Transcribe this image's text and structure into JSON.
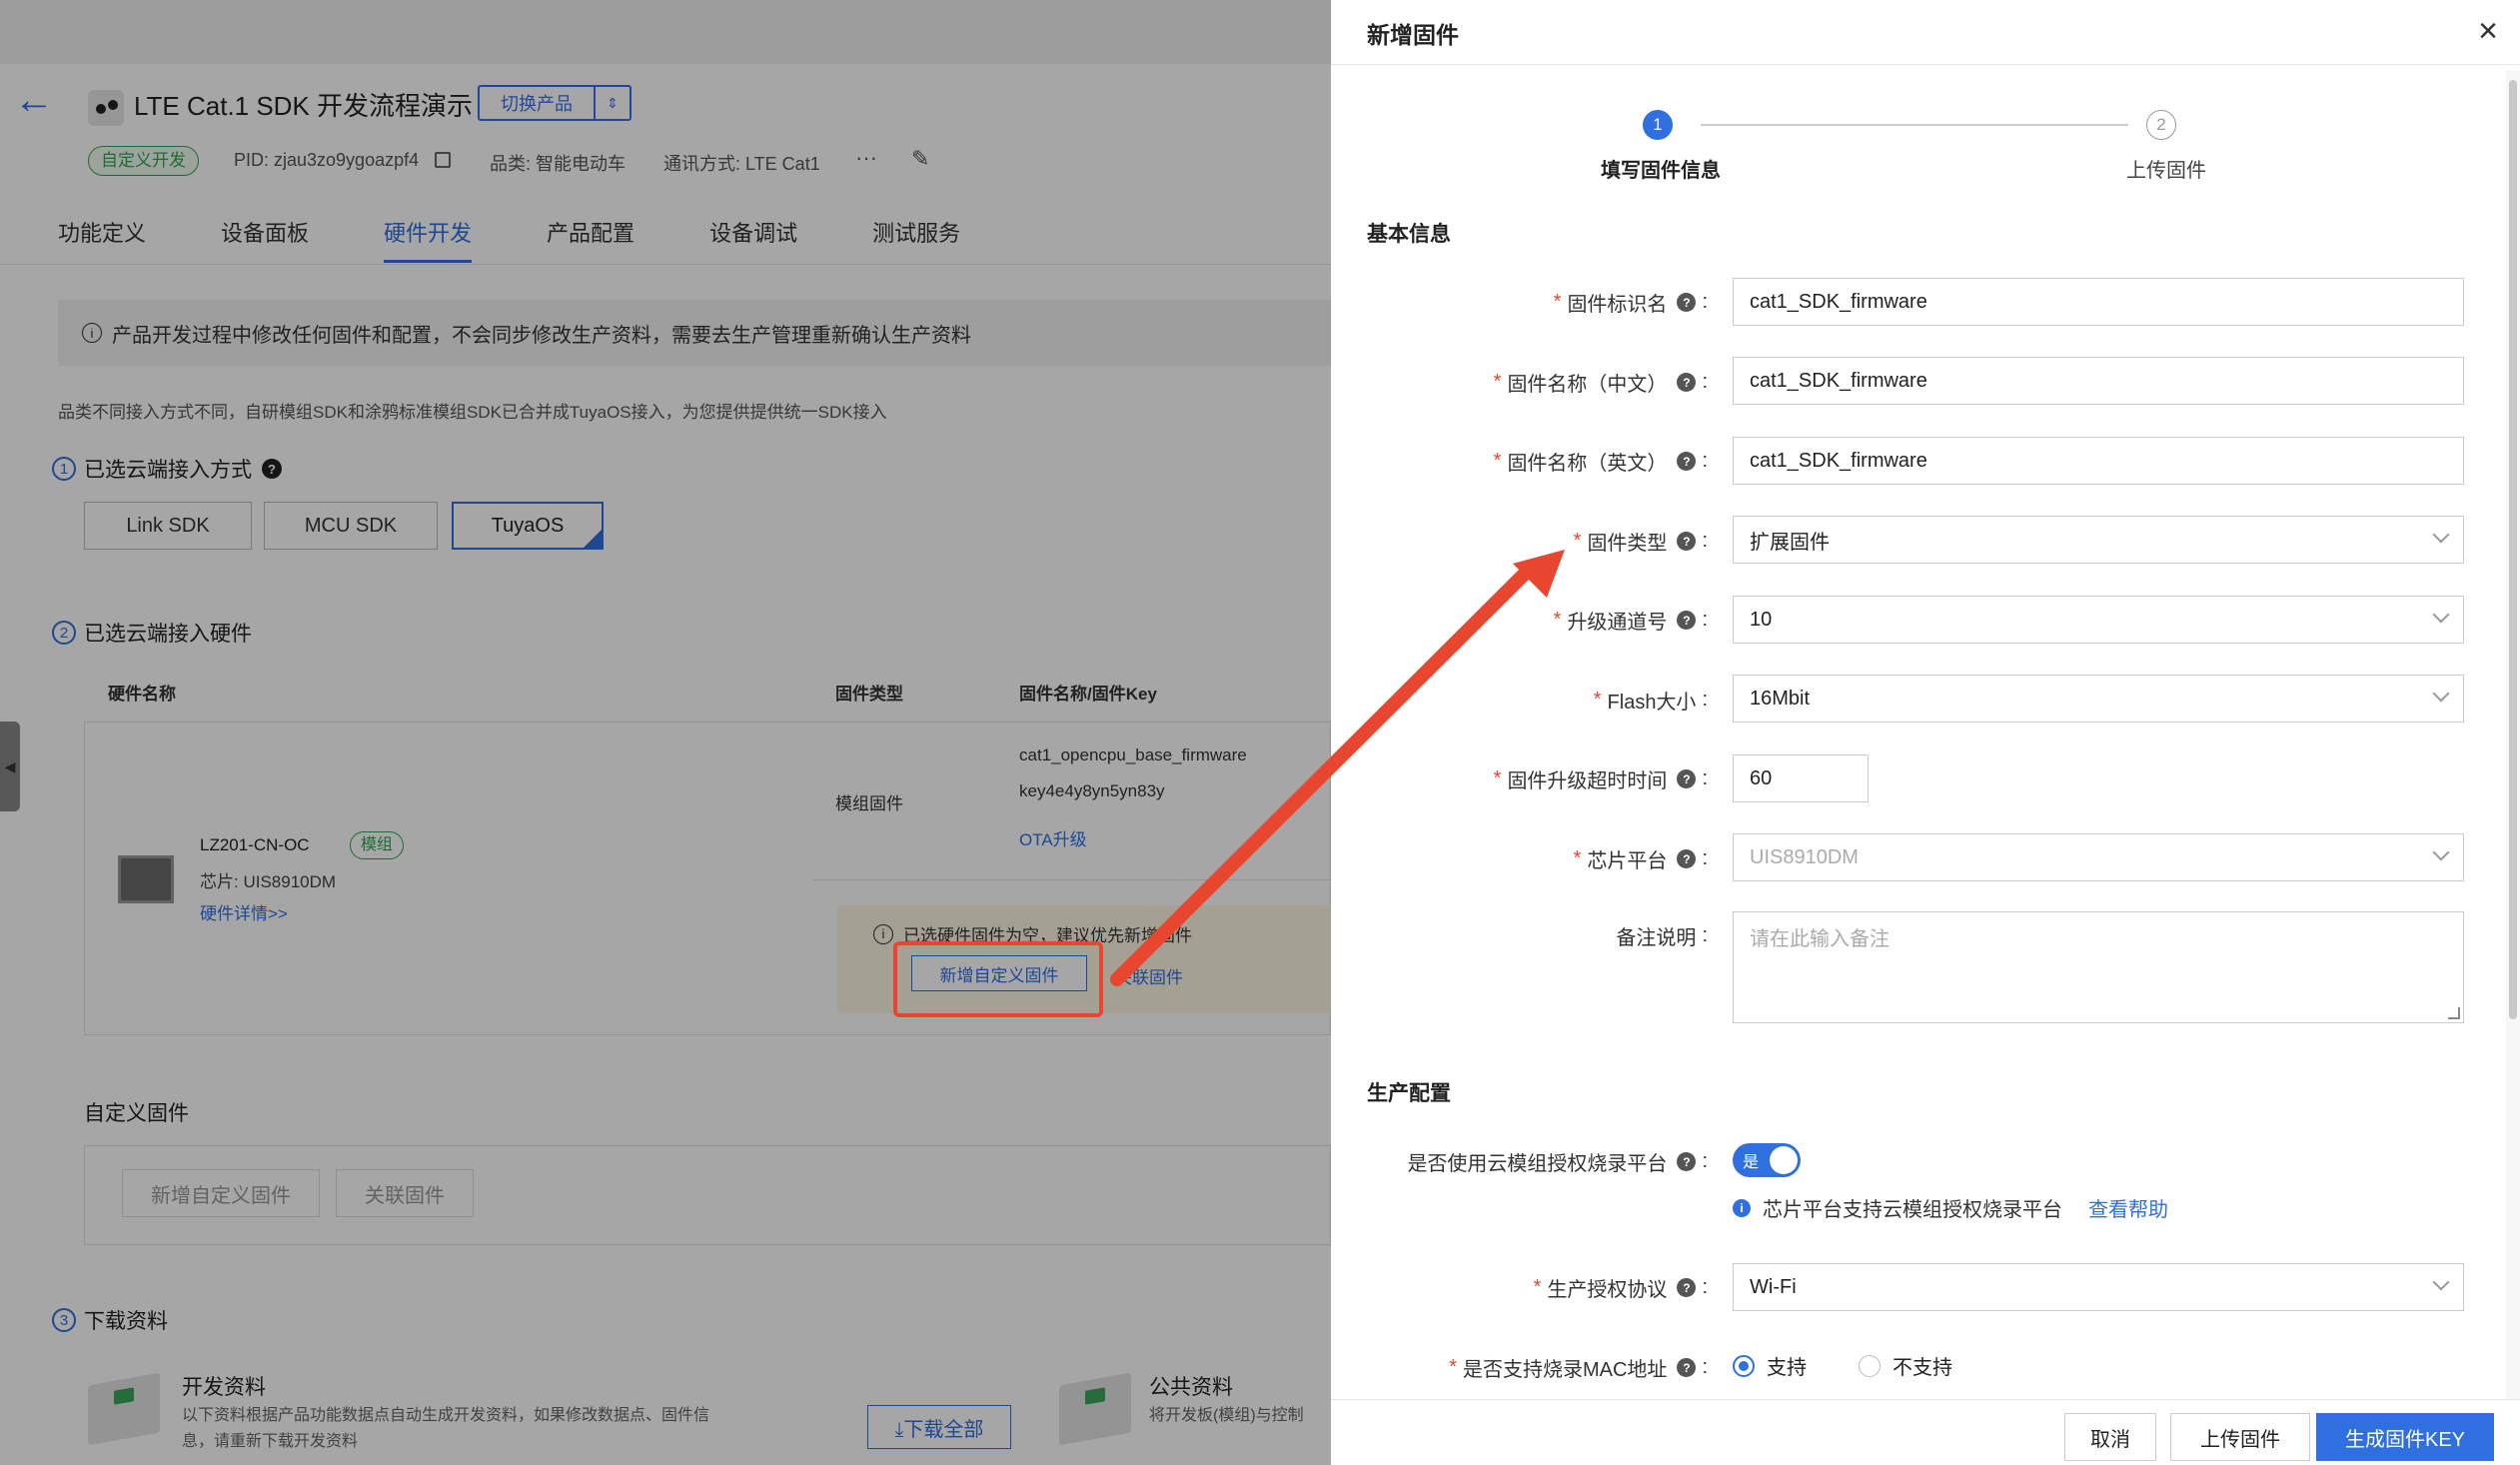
{
  "page": {
    "product_title": "LTE Cat.1 SDK 开发流程演示",
    "switch_product": "切换产品",
    "custom_dev_tag": "自定义开发",
    "pid": "PID: zjau3zo9ygoazpf4",
    "category": "品类: 智能电动车",
    "comm": "通讯方式: LTE Cat1",
    "more": "···",
    "tabs": [
      "功能定义",
      "设备面板",
      "硬件开发",
      "产品配置",
      "设备调试",
      "测试服务"
    ],
    "notice": "产品开发过程中修改任何固件和配置，不会同步修改生产资料，需要去生产管理重新确认生产资料",
    "desc": "品类不同接入方式不同，自研模组SDK和涂鸦标准模组SDK已合并成TuyaOS接入，为您提供提供统一SDK接入",
    "section1": {
      "num": "1",
      "title": "已选云端接入方式"
    },
    "sdk_options": [
      "Link SDK",
      "MCU SDK",
      "TuyaOS"
    ],
    "section2": {
      "num": "2",
      "title": "已选云端接入硬件"
    },
    "table_headers": [
      "硬件名称",
      "固件类型",
      "固件名称/固件Key"
    ],
    "hardware": {
      "name": "LZ201-CN-OC",
      "tag": "模组",
      "chip": "芯片: UIS8910DM",
      "link": "硬件详情>>",
      "fw_type": "模组固件",
      "fw_name": "cat1_opencpu_base_firmware",
      "fw_key": "key4e4y8yn5yn83y",
      "ota": "OTA升级"
    },
    "warning": "已选硬件固件为空，建议优先新增固件",
    "add_custom_fw": "新增自定义固件",
    "link_fw": "关联固件",
    "custom_fw_title": "自定义固件",
    "ghost_add": "新增自定义固件",
    "ghost_link": "关联固件",
    "section3": {
      "num": "3",
      "title": "下载资料"
    },
    "dev_doc_title": "开发资料",
    "dev_doc_desc1": "以下资料根据产品功能数据点自动生成开发资料，如果修改数据点、固件信",
    "dev_doc_desc2": "息，请重新下载开发资料",
    "download_all": "⤓下载全部",
    "public_doc_title": "公共资料",
    "public_doc_desc": "将开发板(模组)与控制"
  },
  "drawer": {
    "title": "新增固件",
    "steps": [
      {
        "num": "1",
        "label": "填写固件信息"
      },
      {
        "num": "2",
        "label": "上传固件"
      }
    ],
    "basic_title": "基本信息",
    "fields": [
      {
        "label": "固件标识名",
        "required": true,
        "help": true,
        "value": "cat1_SDK_firmware"
      },
      {
        "label": "固件名称（中文）",
        "required": true,
        "help": true,
        "value": "cat1_SDK_firmware"
      },
      {
        "label": "固件名称（英文）",
        "required": true,
        "help": true,
        "value": "cat1_SDK_firmware"
      },
      {
        "label": "固件类型",
        "required": true,
        "help": true,
        "value": "扩展固件"
      },
      {
        "label": "升级通道号",
        "required": true,
        "help": true,
        "value": "10"
      },
      {
        "label": "Flash大小",
        "required": true,
        "help": false,
        "value": "16Mbit"
      },
      {
        "label": "固件升级超时时间",
        "required": true,
        "help": true,
        "value": "60"
      },
      {
        "label": "芯片平台",
        "required": true,
        "help": true,
        "value": "UIS8910DM"
      },
      {
        "label": "备注说明",
        "required": false,
        "help": false,
        "placeholder": "请在此输入备注"
      }
    ],
    "prod_title": "生产配置",
    "cloud_burn_label": "是否使用云模组授权烧录平台",
    "toggle_text": "是",
    "tip": "芯片平台支持云模组授权烧录平台",
    "help_link": "查看帮助",
    "protocol_label": "生产授权协议",
    "protocol_value": "Wi-Fi",
    "mac_label": "是否支持烧录MAC地址",
    "mac_options": [
      "支持",
      "不支持"
    ],
    "mac_selected": "支持",
    "buttons": {
      "cancel": "取消",
      "upload": "上传固件",
      "generate": "生成固件KEY"
    }
  },
  "colors": {
    "accent": "#2f6fe0",
    "highlight": "#e8462e",
    "success": "#2fa64f"
  }
}
